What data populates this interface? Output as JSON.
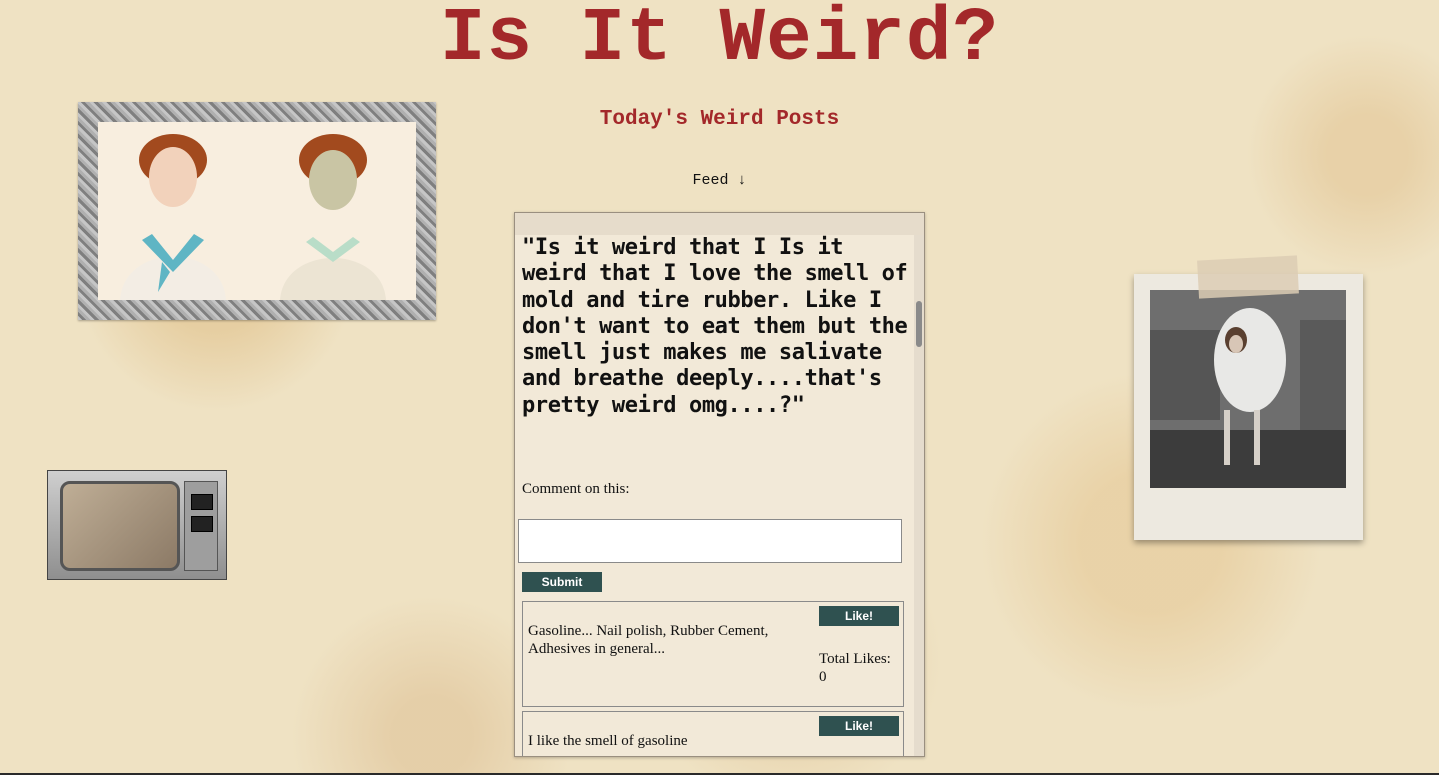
{
  "header": {
    "title": "Is It Weird?",
    "subtitle": "Today's Weird Posts",
    "feed_link": "Feed ↓"
  },
  "post": {
    "text": "\"Is it weird that I Is it weird that I love the smell of mold and tire rubber. Like I don't want to eat them but the smell just makes me salivate and breathe deeply....that's pretty weird omg....?\"",
    "comment_label": "Comment on this:",
    "comment_input_value": "",
    "submit_label": "Submit"
  },
  "comments": [
    {
      "text": "Gasoline... Nail polish, Rubber Cement, Adhesives in general...",
      "like_label": "Like!",
      "likes_label": "Total Likes:",
      "likes": "0"
    },
    {
      "text": "I like the smell of gasoline",
      "like_label": "Like!"
    }
  ],
  "colors": {
    "accent": "#a3282a",
    "button": "#2f5150",
    "background": "#efe2c3"
  }
}
